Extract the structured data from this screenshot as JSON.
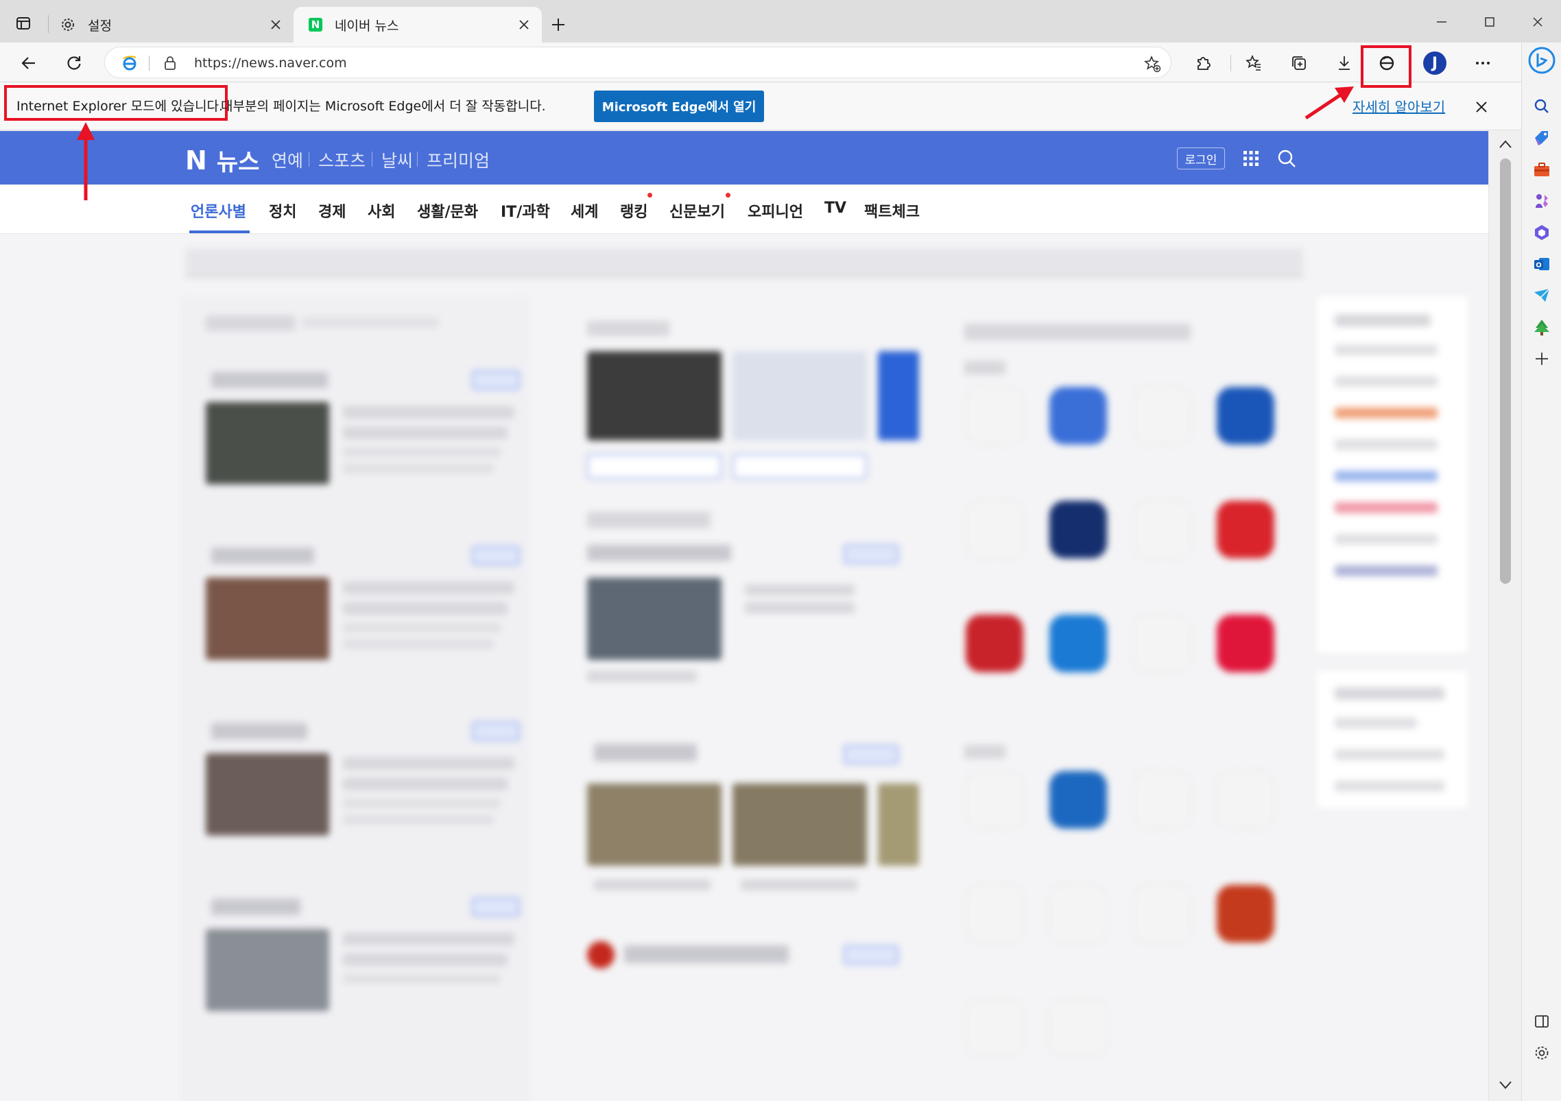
{
  "tabs": [
    {
      "title": "설정",
      "icon": "gear-icon"
    },
    {
      "title": "네이버 뉴스",
      "icon": "naver-favicon"
    }
  ],
  "address": {
    "url": "https://news.naver.com"
  },
  "infobar": {
    "message_part1": "Internet Explorer 모드에 있습니다.",
    "message_part2": "대부분의 페이지는 Microsoft Edge에서 더 잘 작동합니다.",
    "open_button": "Microsoft Edge에서 열기",
    "learn_more": "자세히 알아보기"
  },
  "profile": {
    "initial": "J"
  },
  "naver": {
    "logo_n": "N",
    "logo_text": "뉴스",
    "header_links": [
      "연예",
      "스포츠",
      "날씨",
      "프리미엄"
    ],
    "login": "로그인",
    "nav": [
      "언론사별",
      "정치",
      "경제",
      "사회",
      "생활/문화",
      "IT/과학",
      "세계",
      "랭킹",
      "신문보기",
      "오피니언",
      "TV",
      "팩트체크"
    ],
    "active_nav": "언론사별"
  },
  "colors": {
    "naver_blue": "#4a6fd8",
    "edge_blue": "#0f6cbd",
    "annotation_red": "#e81224"
  }
}
